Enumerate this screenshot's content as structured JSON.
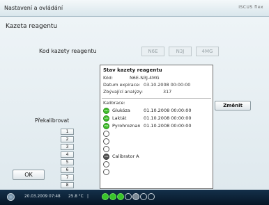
{
  "window": {
    "title": "Nastavení a ovládání",
    "brand": "ISCUS flex"
  },
  "page": {
    "title": "Kazeta reagentu"
  },
  "cassette": {
    "label": "Kod kazety reagentu",
    "codes": [
      "N6E",
      "N3J",
      "4MG"
    ]
  },
  "status": {
    "heading": "Stav kazety reagentu",
    "fields": [
      {
        "label": "Kód:",
        "value": "N6E-N3J-4MG"
      },
      {
        "label": "Datum expirace:",
        "value": "03.10.2008 00:00:00"
      },
      {
        "label": "Zbývající analýzy:",
        "value": "317"
      }
    ],
    "calibration_label": "Kalibrace:",
    "calibrations": [
      {
        "badge": "GLU",
        "name": "Glukóza",
        "date": "01.10.2008 00:00:00",
        "state": "green"
      },
      {
        "badge": "LAC",
        "name": "Laktát",
        "date": "01.10.2008 00:00:00",
        "state": "green"
      },
      {
        "badge": "PYR",
        "name": "Pyrohroznan",
        "date": "01.10.2008 00:00:00",
        "state": "green"
      },
      {
        "badge": "",
        "name": "",
        "date": "",
        "state": "empty"
      },
      {
        "badge": "",
        "name": "",
        "date": "",
        "state": "empty"
      },
      {
        "badge": "",
        "name": "",
        "date": "",
        "state": "empty"
      },
      {
        "badge": "CAL",
        "name": "Calibrator A",
        "date": "",
        "state": "dark"
      },
      {
        "badge": "",
        "name": "",
        "date": "",
        "state": "empty"
      },
      {
        "badge": "",
        "name": "",
        "date": "",
        "state": "empty"
      }
    ]
  },
  "buttons": {
    "change": "Změnit",
    "ok": "OK"
  },
  "recalibrate": {
    "label": "Překalibrovat",
    "numbers": [
      "1",
      "2",
      "3",
      "4",
      "5",
      "6",
      "7",
      "8"
    ]
  },
  "taskbar": {
    "datetime": "20.03.2009 07:48",
    "temperature": "25.8 °C",
    "separator": "|"
  },
  "colors": {
    "accent_green": "#3fc02a",
    "taskbar_bg": "#0b2136"
  }
}
